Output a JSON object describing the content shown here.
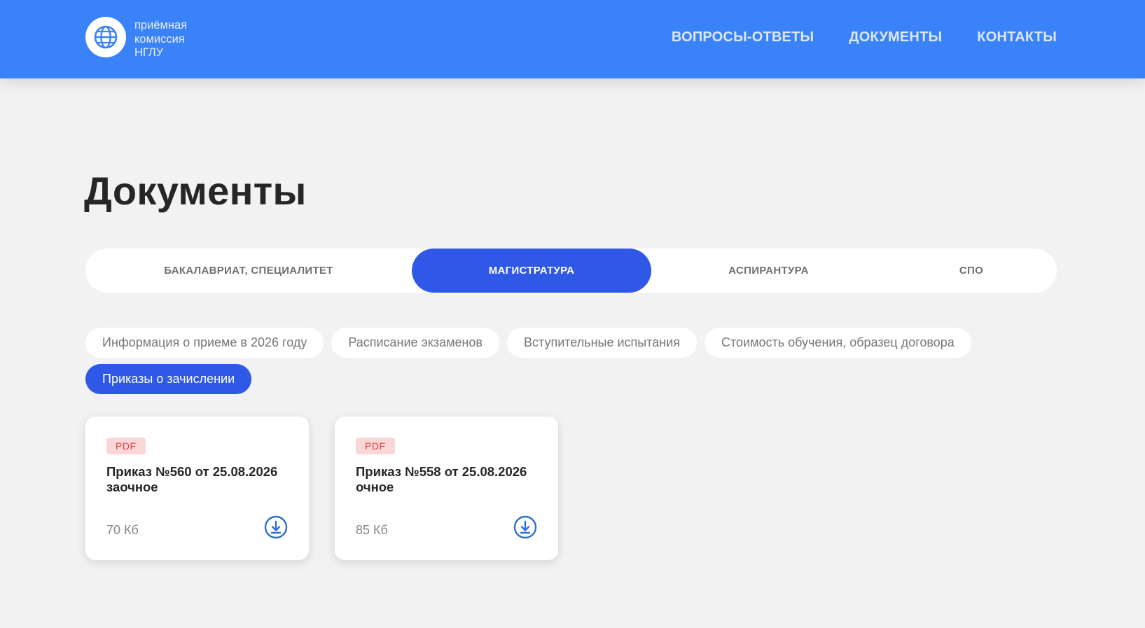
{
  "header": {
    "logo_lines": [
      "приёмная",
      "комиссия",
      "НГЛУ"
    ],
    "nav": [
      "ВОПРОСЫ-ОТВЕТЫ",
      "ДОКУМЕНТЫ",
      "КОНТАКТЫ"
    ]
  },
  "page": {
    "title": "Документы"
  },
  "level_tabs": [
    {
      "label": "БАКАЛАВРИАТ, СПЕЦИАЛИТЕТ",
      "active": false
    },
    {
      "label": "МАГИСТРАТУРА",
      "active": true
    },
    {
      "label": "АСПИРАНТУРА",
      "active": false
    },
    {
      "label": "СПО",
      "active": false
    }
  ],
  "sub_tabs": [
    {
      "label": "Информация о приеме в 2026 году",
      "active": false
    },
    {
      "label": "Расписание экзаменов",
      "active": false
    },
    {
      "label": "Вступительные испытания",
      "active": false
    },
    {
      "label": "Стоимость обучения, образец договора",
      "active": false
    },
    {
      "label": "Приказы о зачислении",
      "active": true
    }
  ],
  "documents": [
    {
      "type": "PDF",
      "title_line1": "Приказ №560 от 25.08.2026",
      "title_line2": "заочное",
      "size": "70 Кб"
    },
    {
      "type": "PDF",
      "title_line1": "Приказ №558 от 25.08.2026",
      "title_line2": "очное",
      "size": "85 Кб"
    }
  ],
  "colors": {
    "header_bg": "#3a82f7",
    "accent": "#2f58e6",
    "pdf_badge_bg": "#fbd6d6",
    "pdf_badge_text": "#d64545",
    "download_icon": "#2f6fd0"
  }
}
